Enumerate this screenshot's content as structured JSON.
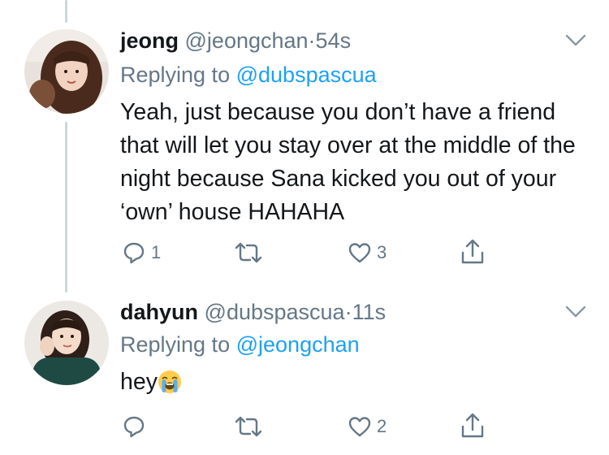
{
  "tweets": [
    {
      "name": "jeong",
      "handle": "@jeongchan",
      "separator": "·",
      "time": "54s",
      "replying_prefix": "Replying to",
      "replying_to": "@dubspascua",
      "text": "Yeah, just because you don’t have a friend that will let you stay over at the middle of the night because Sana kicked you out of your ‘own’ house HAHAHA",
      "reply_count": "1",
      "retweet_count": "",
      "like_count": "3"
    },
    {
      "name": "dahyun",
      "handle": "@dubspascua",
      "separator": "·",
      "time": "11s",
      "replying_prefix": "Replying to",
      "replying_to": "@jeongchan",
      "text": "hey",
      "emoji": "loudly-crying-face",
      "reply_count": "",
      "retweet_count": "",
      "like_count": "2"
    }
  ],
  "colors": {
    "text": "#14171a",
    "muted": "#657786",
    "link": "#1da1f2",
    "thread_line": "#ccd6dd"
  },
  "icons": [
    "chevron-down-icon",
    "reply-icon",
    "retweet-icon",
    "like-icon",
    "share-icon"
  ]
}
